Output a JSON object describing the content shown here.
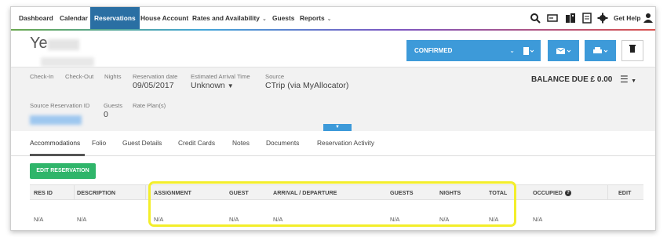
{
  "nav": {
    "items": [
      {
        "label": "Dashboard"
      },
      {
        "label": "Calendar"
      },
      {
        "label": "Reservations"
      },
      {
        "label": "House Account"
      },
      {
        "label": "Rates and Availability"
      },
      {
        "label": "Guests"
      },
      {
        "label": "Reports"
      }
    ],
    "caret": "⌄",
    "help_label": "Get Help"
  },
  "reservation": {
    "guest_name": "Ye",
    "status": "CONFIRMED",
    "balance_due": "BALANCE DUE £ 0.00",
    "fields": {
      "check_in_label": "Check-In",
      "check_out_label": "Check-Out",
      "nights_label": "Nights",
      "reservation_date_label": "Reservation date",
      "reservation_date": "09/05/2017",
      "eta_label": "Estimated Arrival Time",
      "eta_value": "Unknown",
      "source_label": "Source",
      "source_value": "CTrip (via MyAllocator)",
      "source_res_id_label": "Source Reservation ID",
      "guests_label": "Guests",
      "guests_value": "0",
      "rate_plans_label": "Rate Plan(s)"
    }
  },
  "tabs": [
    {
      "label": "Accommodations",
      "active": true
    },
    {
      "label": "Folio"
    },
    {
      "label": "Guest Details"
    },
    {
      "label": "Credit Cards"
    },
    {
      "label": "Notes"
    },
    {
      "label": "Documents"
    },
    {
      "label": "Reservation Activity"
    }
  ],
  "edit_button": "EDIT RESERVATION",
  "table": {
    "headers": [
      "RES ID",
      "DESCRIPTION",
      "ASSIGNMENT",
      "GUEST",
      "ARRIVAL / DEPARTURE",
      "GUESTS",
      "NIGHTS",
      "TOTAL",
      "OCCUPIED",
      "EDIT"
    ],
    "row": [
      "N/A",
      "N/A",
      "N/A",
      "N/A",
      "N/A",
      "N/A",
      "N/A",
      "N/A",
      "N/A"
    ]
  },
  "colors": {
    "accent": "#3d9ad9",
    "nav_active": "#2a6fa3",
    "edit_button": "#2fb56a",
    "highlight": "#f3ee2a"
  }
}
